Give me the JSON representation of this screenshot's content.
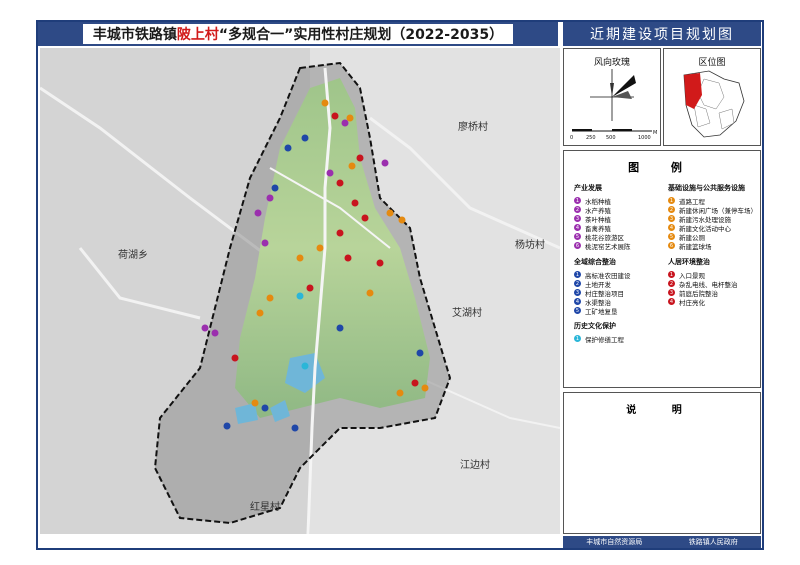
{
  "title": {
    "prefix": "丰城市铁路镇",
    "village": "陂上村",
    "suffix": "“多规合一”实用性村庄规划（2022-2035）"
  },
  "sheet_name": "近期建设项目规划图",
  "neighbors": {
    "north_east": "廖桥村",
    "west": "荷湖乡",
    "east": "杨坊村",
    "east_center": "艾湖村",
    "south_east": "江边村",
    "south": "红星村"
  },
  "wind_rose": {
    "title": "风向玫瑰",
    "scale_ticks": [
      "0",
      "250",
      "500",
      "1000"
    ],
    "scale_unit": "M"
  },
  "location": {
    "title": "区位图"
  },
  "legend": {
    "title": "图  例",
    "industry": {
      "heading": "产业发展",
      "items": [
        {
          "num": "1",
          "label": "水稻种植",
          "color": "#9b2fae"
        },
        {
          "num": "2",
          "label": "水产养殖",
          "color": "#9b2fae"
        },
        {
          "num": "3",
          "label": "茶叶种植",
          "color": "#9b2fae"
        },
        {
          "num": "4",
          "label": "畜禽养殖",
          "color": "#9b2fae"
        },
        {
          "num": "5",
          "label": "桃花谷旅游区",
          "color": "#9b2fae"
        },
        {
          "num": "6",
          "label": "桃泥窑艺术展陈",
          "color": "#9b2fae"
        }
      ]
    },
    "infrastructure": {
      "heading": "基础设施与公共服务设施",
      "items": [
        {
          "num": "1",
          "label": "道路工程",
          "color": "#e58a10"
        },
        {
          "num": "2",
          "label": "新建休闲广场（兼停车场）",
          "color": "#e58a10"
        },
        {
          "num": "3",
          "label": "新建污水处理设施",
          "color": "#e58a10"
        },
        {
          "num": "4",
          "label": "新建文化活动中心",
          "color": "#e58a10"
        },
        {
          "num": "5",
          "label": "新建公厕",
          "color": "#e58a10"
        },
        {
          "num": "6",
          "label": "新建篮球场",
          "color": "#e58a10"
        }
      ]
    },
    "land": {
      "heading": "全域综合整治",
      "items": [
        {
          "num": "1",
          "label": "高标准农田建设",
          "color": "#1f47a8"
        },
        {
          "num": "2",
          "label": "土地开发",
          "color": "#1f47a8"
        },
        {
          "num": "3",
          "label": "村庄整治项目",
          "color": "#1f47a8"
        },
        {
          "num": "4",
          "label": "水渠整治",
          "color": "#1f47a8"
        },
        {
          "num": "5",
          "label": "工矿地复垦",
          "color": "#1f47a8"
        }
      ]
    },
    "environment": {
      "heading": "人居环境整治",
      "items": [
        {
          "num": "1",
          "label": "入口景观",
          "color": "#c8141e"
        },
        {
          "num": "2",
          "label": "杂乱电线、电杆整治",
          "color": "#c8141e"
        },
        {
          "num": "3",
          "label": "前庭后院整治",
          "color": "#c8141e"
        },
        {
          "num": "4",
          "label": "村庄亮化",
          "color": "#c8141e"
        }
      ]
    },
    "heritage": {
      "heading": "历史文化保护",
      "items": [
        {
          "num": "1",
          "label": "保护修缮工程",
          "color": "#2bb6d8"
        }
      ]
    }
  },
  "notes": {
    "title": "说  明"
  },
  "footer": {
    "left": "丰城市自然资源局",
    "right": "铁路镇人民政府"
  },
  "colors": {
    "frame": "#1f3d7a",
    "title_bar": "#2e4a86",
    "highlight_red": "#d11a1a"
  }
}
